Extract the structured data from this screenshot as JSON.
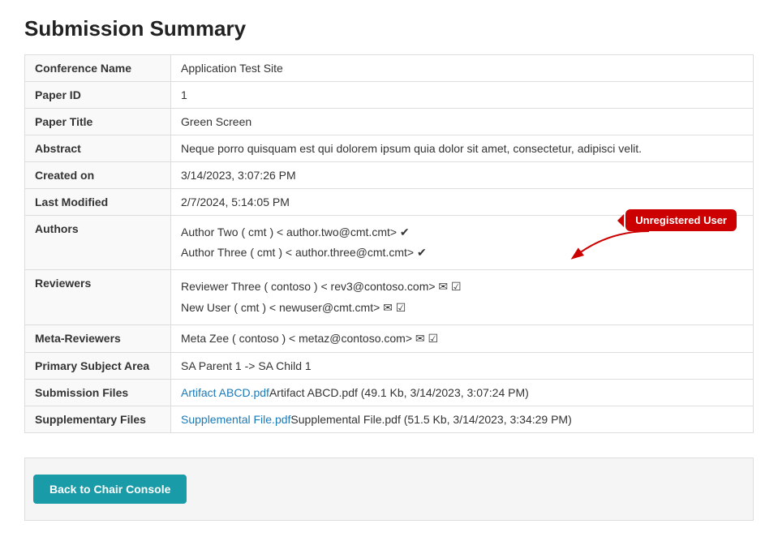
{
  "page": {
    "title": "Submission Summary"
  },
  "table": {
    "rows": [
      {
        "label": "Conference Name",
        "value": "Application Test Site",
        "type": "text"
      },
      {
        "label": "Paper ID",
        "value": "1",
        "type": "text"
      },
      {
        "label": "Paper Title",
        "value": "Green Screen",
        "type": "text"
      },
      {
        "label": "Abstract",
        "value": "Neque porro quisquam est qui dolorem ipsum quia dolor sit amet, consectetur, adipisci velit.",
        "type": "text"
      },
      {
        "label": "Created on",
        "value": "3/14/2023, 3:07:26 PM",
        "type": "text"
      },
      {
        "label": "Last Modified",
        "value": "2/7/2024, 5:14:05 PM",
        "type": "text"
      },
      {
        "label": "Authors",
        "type": "authors",
        "lines": [
          "Author Two ( cmt ) < author.two@cmt.cmt> ✔",
          "Author Three ( cmt ) < author.three@cmt.cmt> ✔"
        ],
        "tooltip": "Unregistered User"
      },
      {
        "label": "Reviewers",
        "type": "reviewers",
        "lines": [
          "Reviewer Three ( contoso ) < rev3@contoso.com> ✉ ☑",
          "New User ( cmt ) < newuser@cmt.cmt> ✉ ☑"
        ]
      },
      {
        "label": "Meta-Reviewers",
        "type": "text",
        "value": "Meta Zee ( contoso ) < metaz@contoso.com> ✉ ☑"
      },
      {
        "label": "Primary Subject Area",
        "value": "SA Parent 1 -> SA Child 1",
        "type": "text"
      },
      {
        "label": "Submission Files",
        "type": "files",
        "link_text": "Artifact ABCD.pdf",
        "rest_text": "Artifact ABCD.pdf  (49.1 Kb, 3/14/2023, 3:07:24 PM)"
      },
      {
        "label": "Supplementary Files",
        "type": "files",
        "link_text": "Supplemental File.pdf",
        "rest_text": "Supplemental File.pdf  (51.5 Kb, 3/14/2023, 3:34:29 PM)"
      }
    ]
  },
  "footer": {
    "back_button_label": "Back to Chair Console"
  }
}
